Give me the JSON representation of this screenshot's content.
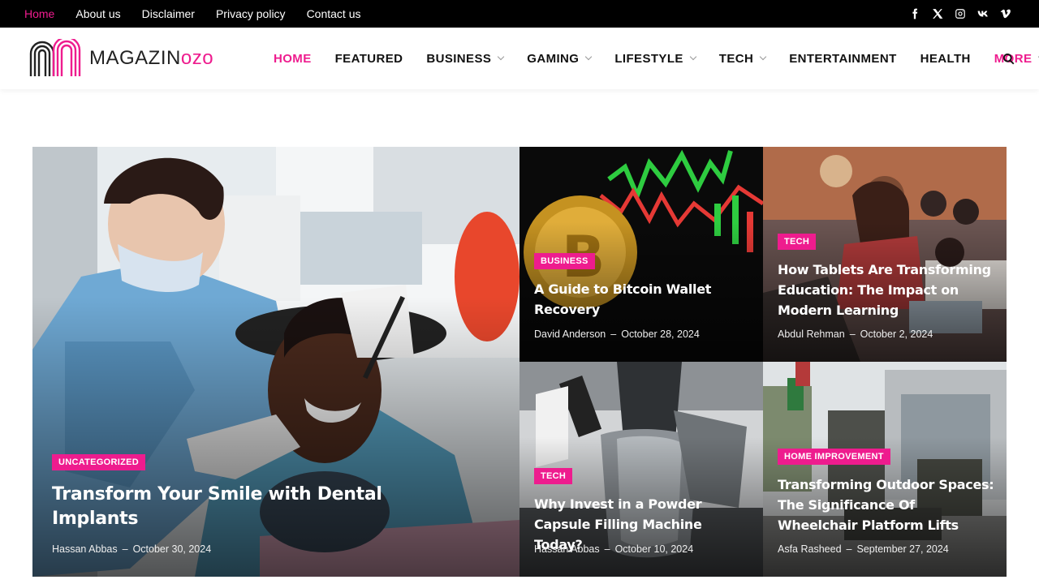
{
  "topbar": {
    "links": [
      "Home",
      "About us",
      "Disclaimer",
      "Privacy policy",
      "Contact us"
    ],
    "social_icons": [
      "facebook-icon",
      "x-icon",
      "instagram-icon",
      "vk-icon",
      "vimeo-icon"
    ]
  },
  "header": {
    "logo_part1": "MAGAZIN",
    "logo_part2": "ozo",
    "nav": [
      "HOME",
      "FEATURED",
      "BUSINESS",
      "GAMING",
      "LIFESTYLE",
      "TECH",
      "ENTERTAINMENT",
      "HEALTH",
      "MORE"
    ]
  },
  "colors": {
    "accent": "#ee1c8e",
    "topbar": "#000000"
  },
  "posts": [
    {
      "category": "UNCATEGORIZED",
      "title": "Transform Your Smile with Dental Implants",
      "author": "Hassan Abbas",
      "date": "October 30, 2024"
    },
    {
      "category": "BUSINESS",
      "title": "A Guide to Bitcoin Wallet Recovery",
      "author": "David Anderson",
      "date": "October 28, 2024"
    },
    {
      "category": "TECH",
      "title": "How Tablets Are Transforming Education: The Impact on Modern Learning",
      "author": "Abdul Rehman",
      "date": "October 2, 2024"
    },
    {
      "category": "TECH",
      "title": "Why Invest in a Powder Capsule Filling Machine Today?",
      "author": "Hassan Abbas",
      "date": "October 10, 2024"
    },
    {
      "category": "HOME IMPROVEMENT",
      "title": "Transforming Outdoor Spaces: The Significance Of Wheelchair Platform Lifts",
      "author": "Asfa Rasheed",
      "date": "September 27, 2024"
    }
  ]
}
